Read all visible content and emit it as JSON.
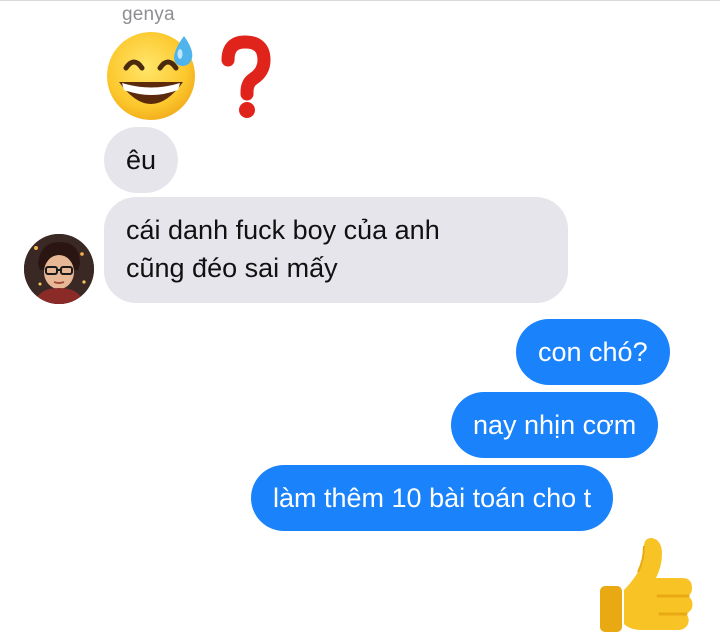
{
  "chat": {
    "sender_name": "genya",
    "reactions": [
      "grinning-face-with-sweat-emoji",
      "red-question-mark-emoji"
    ],
    "incoming": [
      {
        "text": "êu"
      },
      {
        "text": "cái danh fuck boy của anh\ncũng đéo sai mấy"
      }
    ],
    "outgoing": [
      {
        "text": "con chó?"
      },
      {
        "text": "nay nhịn cơm"
      },
      {
        "text": "làm thêm 10 bài toán cho t"
      }
    ],
    "sticker": "thumbs-up-emoji"
  },
  "colors": {
    "incoming_bubble": "#e6e5eb",
    "outgoing_bubble": "#1a82fb",
    "sender_name": "#8e8e93",
    "question_mark": "#e0231b",
    "thumb_yellow": "#f7c325"
  }
}
